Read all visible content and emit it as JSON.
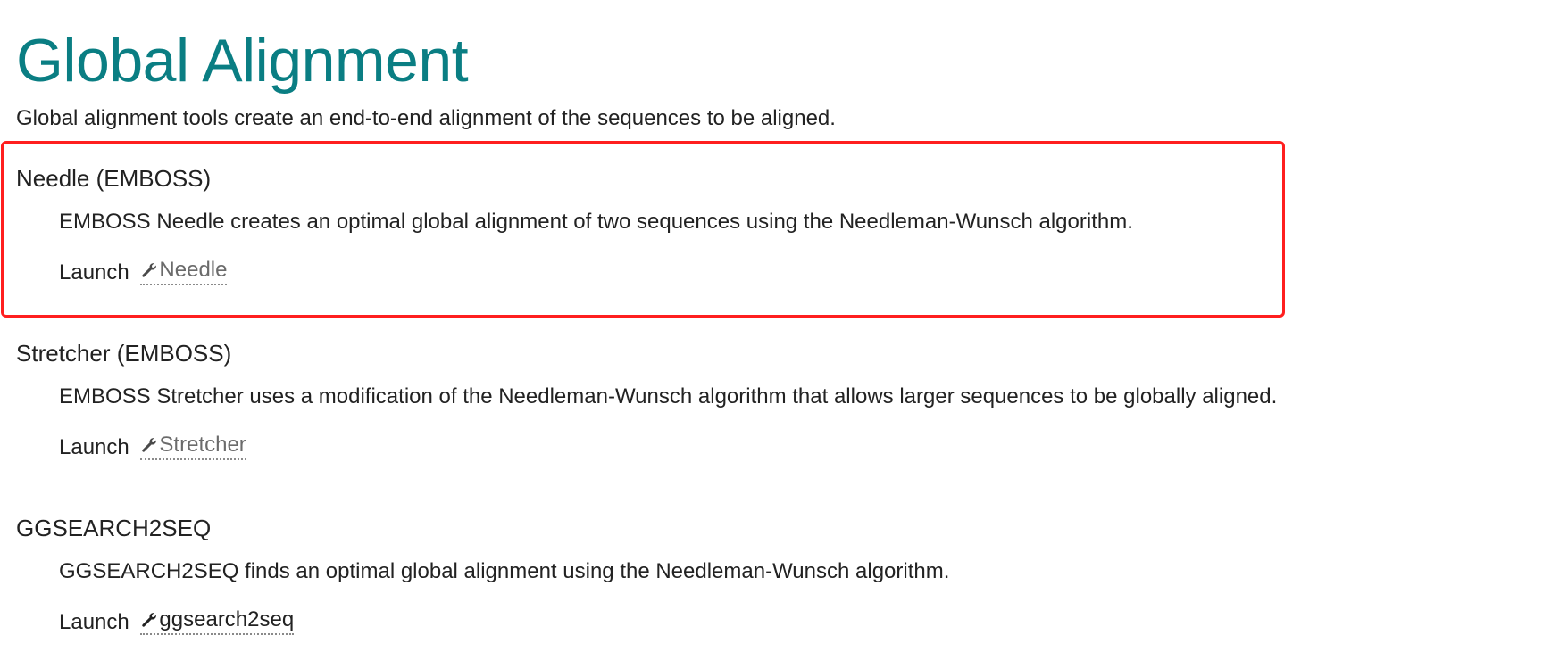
{
  "header": {
    "title": "Global Alignment",
    "intro": "Global alignment tools create an end-to-end alignment of the sequences to be aligned."
  },
  "tools": [
    {
      "name": "Needle (EMBOSS)",
      "description": "EMBOSS Needle creates an optimal global alignment of two sequences using the Needleman-Wunsch algorithm.",
      "launch_label": "Launch",
      "link_text": "Needle",
      "icon": "wrench-icon",
      "highlighted": true
    },
    {
      "name": "Stretcher (EMBOSS)",
      "description": "EMBOSS Stretcher uses a modification of the Needleman-Wunsch algorithm that allows larger sequences to be globally aligned.",
      "launch_label": "Launch",
      "link_text": "Stretcher",
      "icon": "wrench-icon",
      "highlighted": false
    },
    {
      "name": "GGSEARCH2SEQ",
      "description": "GGSEARCH2SEQ finds an optimal global alignment using the Needleman-Wunsch algorithm.",
      "launch_label": "Launch",
      "link_text": "ggsearch2seq",
      "icon": "wrench-icon",
      "highlighted": false
    }
  ],
  "colors": {
    "title": "#0a7e83",
    "highlight_border": "#ff1f1f",
    "link": "#6b6b6b"
  }
}
